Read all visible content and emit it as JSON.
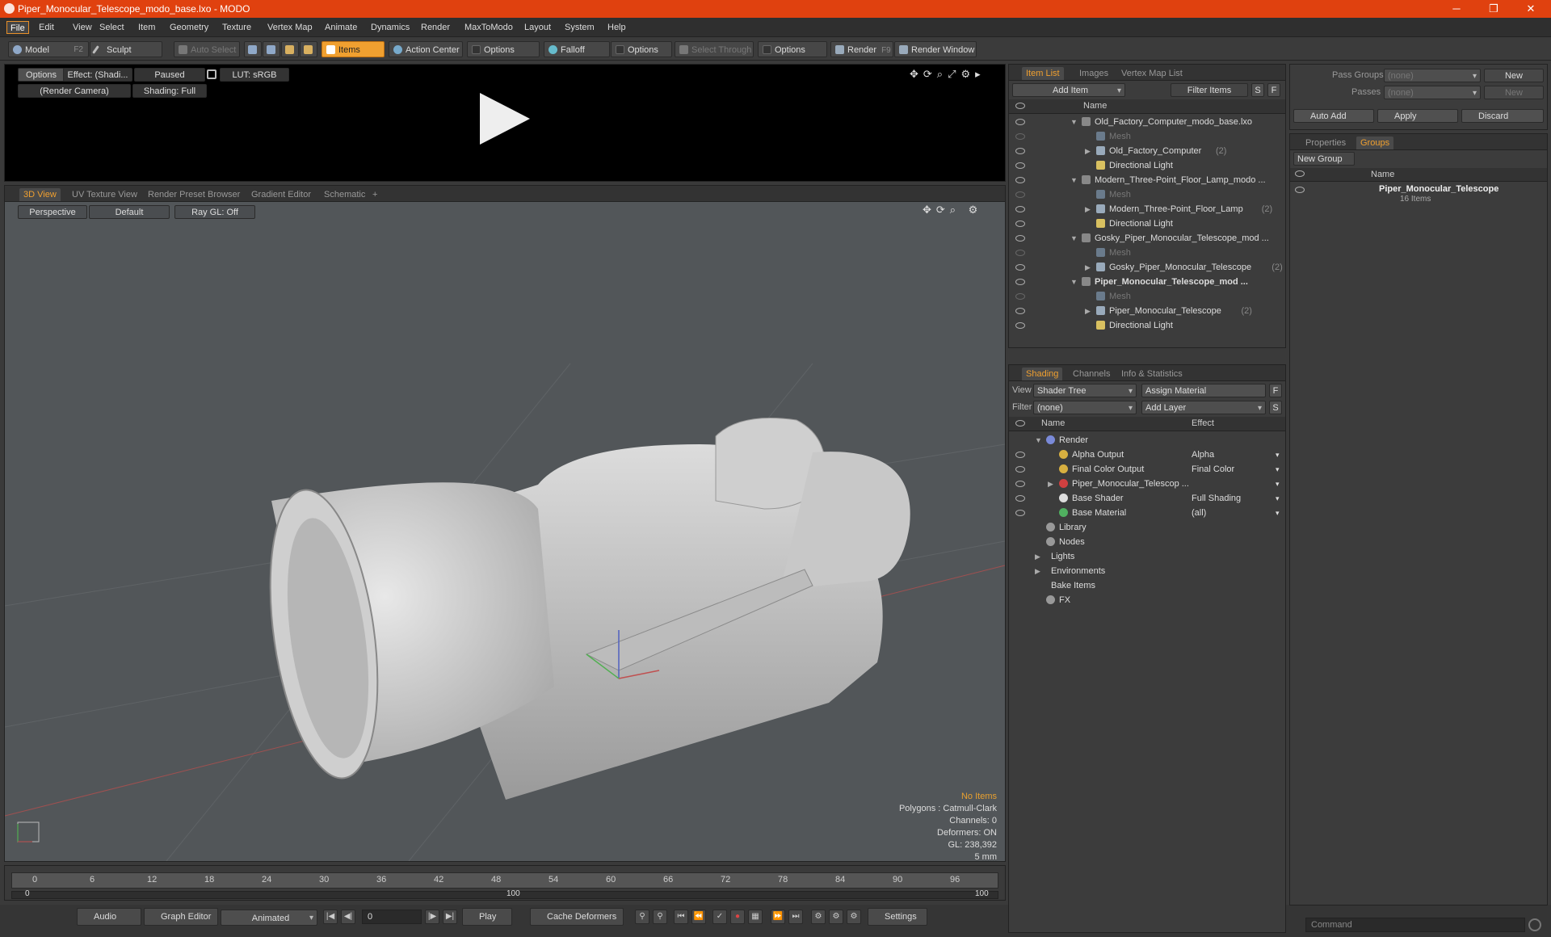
{
  "window": {
    "title": "Piper_Monocular_Telescope_modo_base.lxo - MODO",
    "minimize": "─",
    "maximize": "❐",
    "close": "✕"
  },
  "menu": [
    "File",
    "Edit",
    "View",
    "Select",
    "Item",
    "Geometry",
    "Texture",
    "Vertex Map",
    "Animate",
    "Dynamics",
    "Render",
    "MaxToModo",
    "Layout",
    "System",
    "Help"
  ],
  "toolbar": {
    "model": "Model",
    "model_key": "F2",
    "sculpt": "Sculpt",
    "auto_select": "Auto Select",
    "items": "Items",
    "action_center": "Action Center",
    "options1": "Options",
    "falloff": "Falloff",
    "options2": "Options",
    "select_through": "Select Through",
    "options3": "Options",
    "render": "Render",
    "render_key": "F9",
    "render_window": "Render Window"
  },
  "preview": {
    "options": "Options",
    "effect": "Effect: (Shadi...",
    "paused": "Paused",
    "lut": "LUT: sRGB",
    "camera": "(Render Camera)",
    "shading": "Shading: Full"
  },
  "viewport": {
    "tabs": [
      "3D View",
      "UV Texture View",
      "Render Preset Browser",
      "Gradient Editor",
      "Schematic"
    ],
    "add_tab": "+",
    "perspective": "Perspective",
    "default": "Default",
    "raygl": "Ray GL: Off",
    "hud": {
      "no_items": "No Items",
      "polygons": "Polygons : Catmull-Clark",
      "channels": "Channels: 0",
      "deformers": "Deformers: ON",
      "gl": "GL: 238,392",
      "scale": "5 mm"
    }
  },
  "timeline": {
    "ticks": [
      "0",
      "6",
      "12",
      "18",
      "24",
      "30",
      "36",
      "42",
      "48",
      "54",
      "60",
      "66",
      "72",
      "78",
      "84",
      "90",
      "96"
    ],
    "bottom_ticks": [
      "0",
      "100",
      "100"
    ]
  },
  "bottombar": {
    "audio": "Audio",
    "graph_editor": "Graph Editor",
    "animated": "Animated",
    "frame": "0",
    "play": "Play",
    "cache_deformers": "Cache Deformers",
    "settings": "Settings"
  },
  "itemlist": {
    "tabs": [
      "Item List",
      "Images",
      "Vertex Map List"
    ],
    "add_item": "Add Item",
    "filter_items": "Filter Items",
    "s": "S",
    "f": "F",
    "col_name": "Name",
    "rows": [
      {
        "label": "Old_Factory_Computer_modo_base.lxo",
        "count": "",
        "indent": 0,
        "kind": "scene",
        "bold": false,
        "dim": false
      },
      {
        "label": "Mesh",
        "count": "",
        "indent": 1,
        "kind": "mesh",
        "bold": false,
        "dim": true
      },
      {
        "label": "Old_Factory_Computer",
        "count": "(2)",
        "indent": 1,
        "kind": "group",
        "bold": false,
        "dim": false
      },
      {
        "label": "Directional Light",
        "count": "",
        "indent": 1,
        "kind": "light",
        "bold": false,
        "dim": false
      },
      {
        "label": "Modern_Three-Point_Floor_Lamp_modo ...",
        "count": "",
        "indent": 0,
        "kind": "scene",
        "bold": false,
        "dim": false
      },
      {
        "label": "Mesh",
        "count": "",
        "indent": 1,
        "kind": "mesh",
        "bold": false,
        "dim": true
      },
      {
        "label": "Modern_Three-Point_Floor_Lamp",
        "count": "(2)",
        "indent": 1,
        "kind": "group",
        "bold": false,
        "dim": false
      },
      {
        "label": "Directional Light",
        "count": "",
        "indent": 1,
        "kind": "light",
        "bold": false,
        "dim": false
      },
      {
        "label": "Gosky_Piper_Monocular_Telescope_mod ...",
        "count": "",
        "indent": 0,
        "kind": "scene",
        "bold": false,
        "dim": false
      },
      {
        "label": "Mesh",
        "count": "",
        "indent": 1,
        "kind": "mesh",
        "bold": false,
        "dim": true
      },
      {
        "label": "Gosky_Piper_Monocular_Telescope",
        "count": "(2)",
        "indent": 1,
        "kind": "group",
        "bold": false,
        "dim": false
      },
      {
        "label": "Piper_Monocular_Telescope_mod ...",
        "count": "",
        "indent": 0,
        "kind": "scene",
        "bold": true,
        "dim": false
      },
      {
        "label": "Mesh",
        "count": "",
        "indent": 1,
        "kind": "mesh",
        "bold": false,
        "dim": true
      },
      {
        "label": "Piper_Monocular_Telescope",
        "count": "(2)",
        "indent": 1,
        "kind": "group",
        "bold": false,
        "dim": false
      },
      {
        "label": "Directional Light",
        "count": "",
        "indent": 1,
        "kind": "light",
        "bold": false,
        "dim": false
      }
    ]
  },
  "shading": {
    "tabs": [
      "Shading",
      "Channels",
      "Info & Statistics"
    ],
    "view_label": "View",
    "view_value": "Shader Tree",
    "assign_material": "Assign Material",
    "f": "F",
    "filter_label": "Filter",
    "filter_value": "(none)",
    "add_layer": "Add Layer",
    "s": "S",
    "col_name": "Name",
    "col_effect": "Effect",
    "rows": [
      {
        "label": "Render",
        "effect": "",
        "indent": 0,
        "color": "#7a8ad8",
        "eye": false,
        "exp": "▼"
      },
      {
        "label": "Alpha Output",
        "effect": "Alpha",
        "indent": 1,
        "color": "#d8b040",
        "eye": true,
        "exp": ""
      },
      {
        "label": "Final Color Output",
        "effect": "Final Color",
        "indent": 1,
        "color": "#d8b040",
        "eye": true,
        "exp": ""
      },
      {
        "label": "Piper_Monocular_Telescop ...",
        "effect": "",
        "indent": 1,
        "color": "#d04040",
        "eye": true,
        "exp": "▶"
      },
      {
        "label": "Base Shader",
        "effect": "Full Shading",
        "indent": 1,
        "color": "#dddddd",
        "eye": true,
        "exp": ""
      },
      {
        "label": "Base Material",
        "effect": "(all)",
        "indent": 1,
        "color": "#50b060",
        "eye": true,
        "exp": ""
      },
      {
        "label": "Library",
        "effect": "",
        "indent": 0,
        "color": "#999999",
        "eye": false,
        "exp": ""
      },
      {
        "label": "Nodes",
        "effect": "",
        "indent": 0,
        "color": "#999999",
        "eye": false,
        "exp": ""
      },
      {
        "label": "Lights",
        "effect": "",
        "indent": -1,
        "color": "",
        "eye": false,
        "exp": "▶"
      },
      {
        "label": "Environments",
        "effect": "",
        "indent": -1,
        "color": "",
        "eye": false,
        "exp": "▶"
      },
      {
        "label": "Bake Items",
        "effect": "",
        "indent": -1,
        "color": "",
        "eye": false,
        "exp": ""
      },
      {
        "label": "FX",
        "effect": "",
        "indent": 0,
        "color": "#999999",
        "eye": false,
        "exp": ""
      }
    ]
  },
  "passes": {
    "pass_groups_label": "Pass Groups",
    "pass_groups_value": "(none)",
    "new1": "New",
    "passes_label": "Passes",
    "passes_value": "(none)",
    "new2": "New",
    "auto_add": "Auto Add",
    "apply": "Apply",
    "discard": "Discard"
  },
  "groups": {
    "tabs": [
      "Properties",
      "Groups"
    ],
    "new_group": "New Group",
    "col_name": "Name",
    "item_name": "Piper_Monocular_Telescope",
    "item_count": "16 Items"
  },
  "command": {
    "placeholder": "Command"
  }
}
